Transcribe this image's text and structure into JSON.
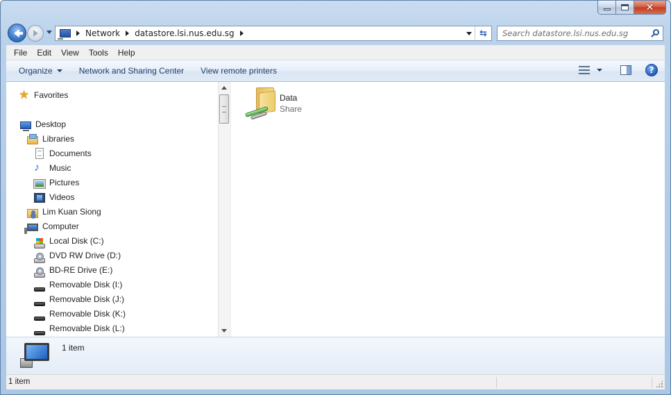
{
  "address_bar": {
    "breadcrumbs": [
      "Network",
      "datastore.lsi.nus.edu.sg"
    ]
  },
  "search": {
    "placeholder": "Search datastore.lsi.nus.edu.sg"
  },
  "menu": {
    "items": [
      "File",
      "Edit",
      "View",
      "Tools",
      "Help"
    ]
  },
  "command_bar": {
    "organize": "Organize",
    "network_sharing": "Network and Sharing Center",
    "remote_printers": "View remote printers",
    "help_glyph": "?"
  },
  "nav_tree": {
    "favorites": "Favorites",
    "desktop": "Desktop",
    "libraries": "Libraries",
    "documents": "Documents",
    "music": "Music",
    "pictures": "Pictures",
    "videos": "Videos",
    "user": "Lim Kuan Siong",
    "computer": "Computer",
    "drives": [
      {
        "label": "Local Disk (C:)",
        "icon": "local-disk-icon"
      },
      {
        "label": "DVD RW Drive (D:)",
        "icon": "dvd-drive-icon"
      },
      {
        "label": "BD-RE Drive (E:)",
        "icon": "bd-drive-icon"
      },
      {
        "label": "Removable Disk (I:)",
        "icon": "removable-disk-icon"
      },
      {
        "label": "Removable Disk (J:)",
        "icon": "removable-disk-icon"
      },
      {
        "label": "Removable Disk (K:)",
        "icon": "removable-disk-icon"
      },
      {
        "label": "Removable Disk (L:)",
        "icon": "removable-disk-icon"
      }
    ]
  },
  "files": [
    {
      "name": "Data",
      "type": "Share",
      "icon": "shared-folder-icon"
    }
  ],
  "details": {
    "item_count": "1 item"
  },
  "status": {
    "text": "1 item"
  },
  "colors": {
    "frame": "#b9d1ea",
    "command_text": "#1e3d66",
    "secondary_text": "#6d6d6d"
  }
}
